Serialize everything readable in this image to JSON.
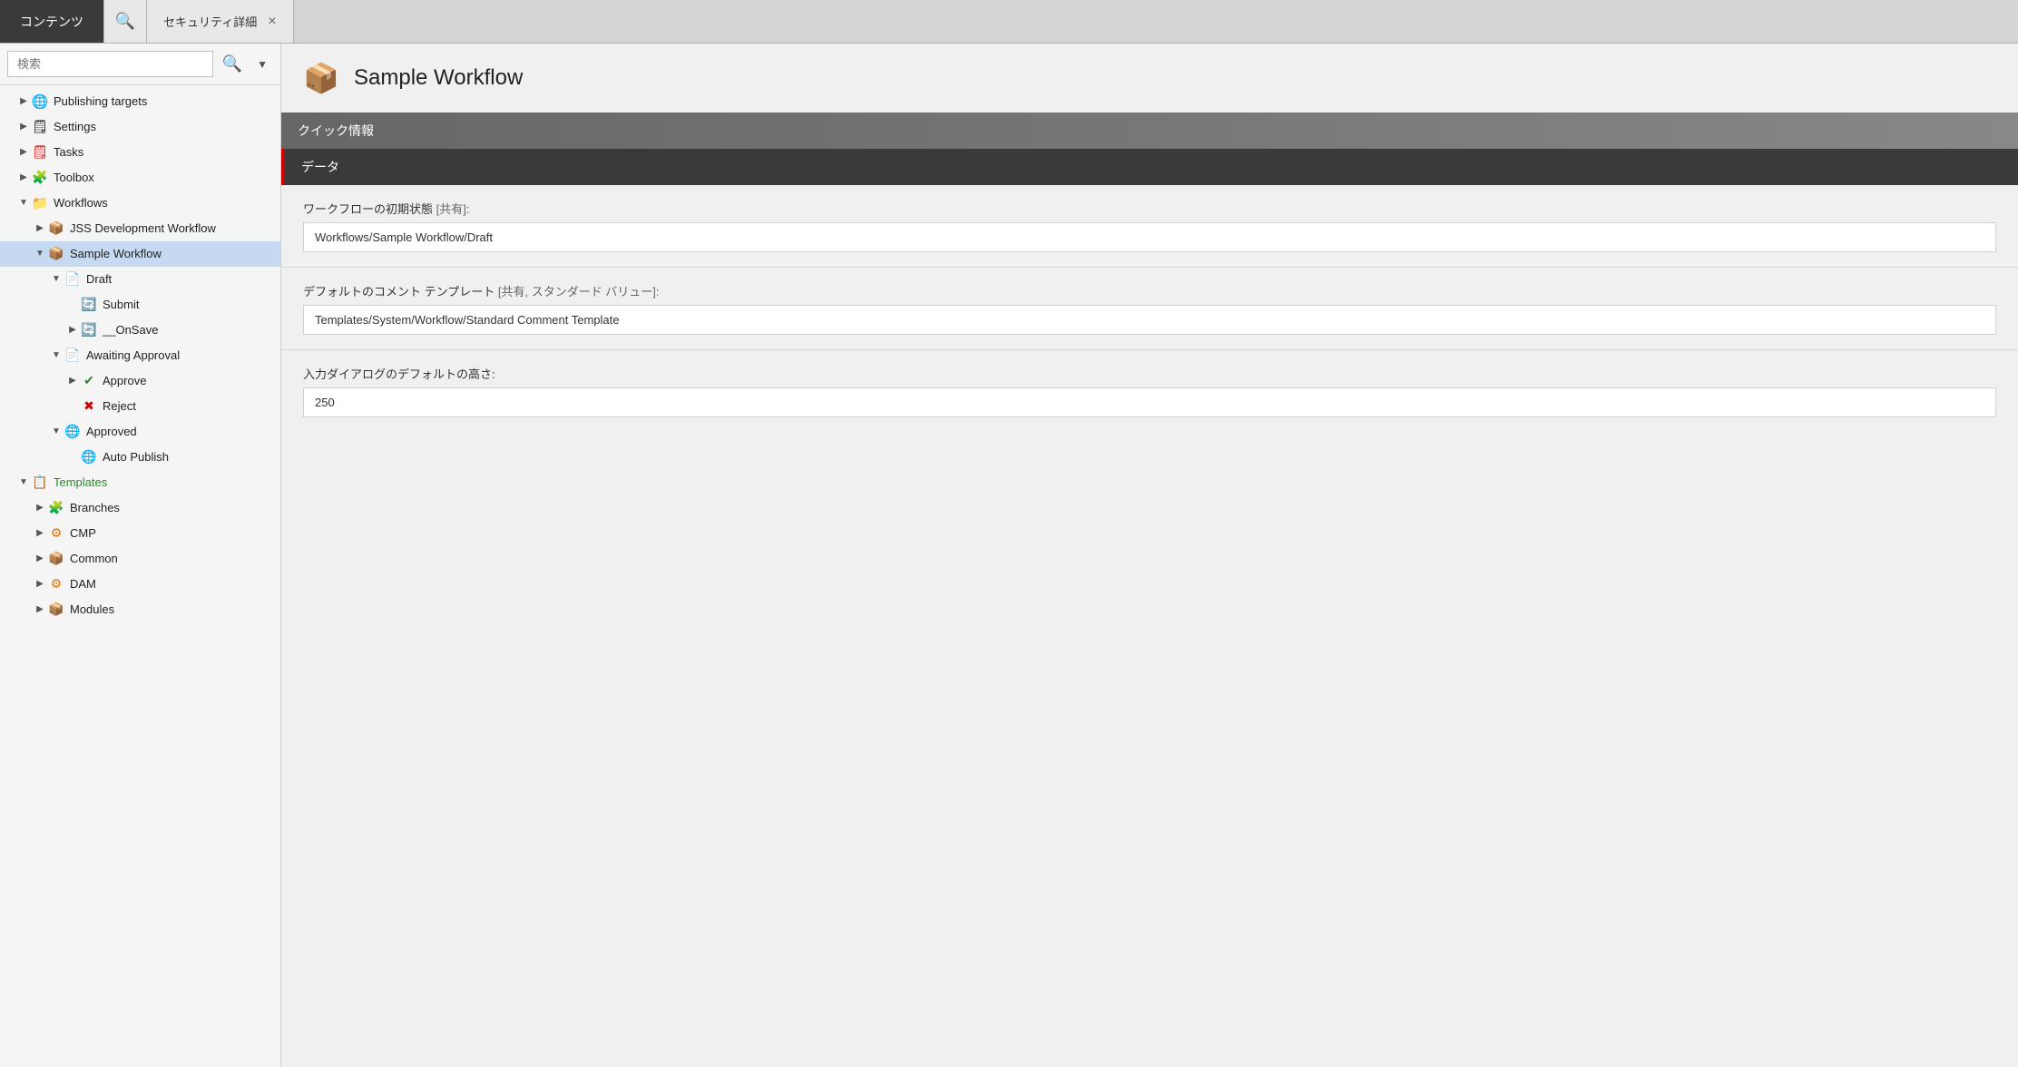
{
  "tabs": {
    "active": "コンテンツ",
    "search_icon": "🔍",
    "inactive": "セキュリティ詳細",
    "close_icon": "×"
  },
  "sidebar": {
    "search_placeholder": "検索",
    "search_icon": "🔍",
    "dropdown_icon": "▼",
    "tree": [
      {
        "id": "publishing-targets",
        "label": "Publishing targets",
        "level": 0,
        "expanded": false,
        "icon": "🌐",
        "icon_type": "globe-blue",
        "toggle": "▶"
      },
      {
        "id": "settings",
        "label": "Settings",
        "level": 0,
        "expanded": false,
        "icon": "📋",
        "icon_type": "checklist-red",
        "toggle": "▶"
      },
      {
        "id": "tasks",
        "label": "Tasks",
        "level": 0,
        "expanded": false,
        "icon": "📋",
        "icon_type": "tasks-red",
        "toggle": "▶"
      },
      {
        "id": "toolbox",
        "label": "Toolbox",
        "level": 0,
        "expanded": false,
        "icon": "🧩",
        "icon_type": "toolbox",
        "toggle": "▶"
      },
      {
        "id": "workflows",
        "label": "Workflows",
        "level": 0,
        "expanded": true,
        "icon": "📁",
        "icon_type": "folder-yellow",
        "toggle": "▼"
      },
      {
        "id": "jss-dev-workflow",
        "label": "JSS Development Workflow",
        "level": 1,
        "expanded": false,
        "icon": "📦",
        "icon_type": "workflow-box",
        "toggle": "▶"
      },
      {
        "id": "sample-workflow",
        "label": "Sample Workflow",
        "level": 1,
        "expanded": true,
        "icon": "📦",
        "icon_type": "workflow-box",
        "toggle": "▼",
        "selected": true
      },
      {
        "id": "draft",
        "label": "Draft",
        "level": 2,
        "expanded": true,
        "icon": "📄",
        "icon_type": "draft",
        "toggle": "▼"
      },
      {
        "id": "submit",
        "label": "Submit",
        "level": 3,
        "expanded": false,
        "icon": "🔄",
        "icon_type": "submit-green",
        "toggle": ""
      },
      {
        "id": "onsave",
        "label": "__OnSave",
        "level": 3,
        "expanded": false,
        "icon": "🔄",
        "icon_type": "onsave-green",
        "toggle": "▶"
      },
      {
        "id": "awaiting-approval",
        "label": "Awaiting Approval",
        "level": 2,
        "expanded": true,
        "icon": "📄",
        "icon_type": "awaiting",
        "toggle": "▼"
      },
      {
        "id": "approve",
        "label": "Approve",
        "level": 3,
        "expanded": false,
        "icon": "✔",
        "icon_type": "approve-green",
        "toggle": "▶"
      },
      {
        "id": "reject",
        "label": "Reject",
        "level": 3,
        "expanded": false,
        "icon": "✖",
        "icon_type": "reject-red",
        "toggle": ""
      },
      {
        "id": "approved",
        "label": "Approved",
        "level": 2,
        "expanded": true,
        "icon": "🌐",
        "icon_type": "approved-globe",
        "toggle": "▼"
      },
      {
        "id": "auto-publish",
        "label": "Auto Publish",
        "level": 3,
        "expanded": false,
        "icon": "🌐",
        "icon_type": "auto-publish-globe",
        "toggle": ""
      },
      {
        "id": "templates",
        "label": "Templates",
        "level": 0,
        "expanded": true,
        "icon": "📋",
        "icon_type": "templates",
        "toggle": "▼",
        "label_color": "green"
      },
      {
        "id": "branches",
        "label": "Branches",
        "level": 1,
        "expanded": false,
        "icon": "🧩",
        "icon_type": "branches",
        "toggle": "▶"
      },
      {
        "id": "cmp",
        "label": "CMP",
        "level": 1,
        "expanded": false,
        "icon": "🔵",
        "icon_type": "cmp",
        "toggle": "▶"
      },
      {
        "id": "common",
        "label": "Common",
        "level": 1,
        "expanded": false,
        "icon": "📦",
        "icon_type": "common-box",
        "toggle": "▶"
      },
      {
        "id": "dam",
        "label": "DAM",
        "level": 1,
        "expanded": false,
        "icon": "🔵",
        "icon_type": "dam",
        "toggle": "▶"
      },
      {
        "id": "modules",
        "label": "Modules",
        "level": 1,
        "expanded": false,
        "icon": "📦",
        "icon_type": "modules-box",
        "toggle": "▶"
      }
    ]
  },
  "content": {
    "title": "Sample Workflow",
    "icon": "📦",
    "quick_info_label": "クイック情報",
    "data_label": "データ",
    "fields": [
      {
        "id": "initial-state",
        "label": "ワークフローの初期状態",
        "shared_label": "[共有]:",
        "value": "Workflows/Sample Workflow/Draft"
      },
      {
        "id": "comment-template",
        "label": "デフォルトのコメント テンプレート",
        "shared_label": "[共有, スタンダード バリュー]:",
        "value": "Templates/System/Workflow/Standard Comment Template"
      },
      {
        "id": "dialog-height",
        "label": "入力ダイアログのデフォルトの高さ:",
        "shared_label": "",
        "value": "250"
      }
    ]
  }
}
